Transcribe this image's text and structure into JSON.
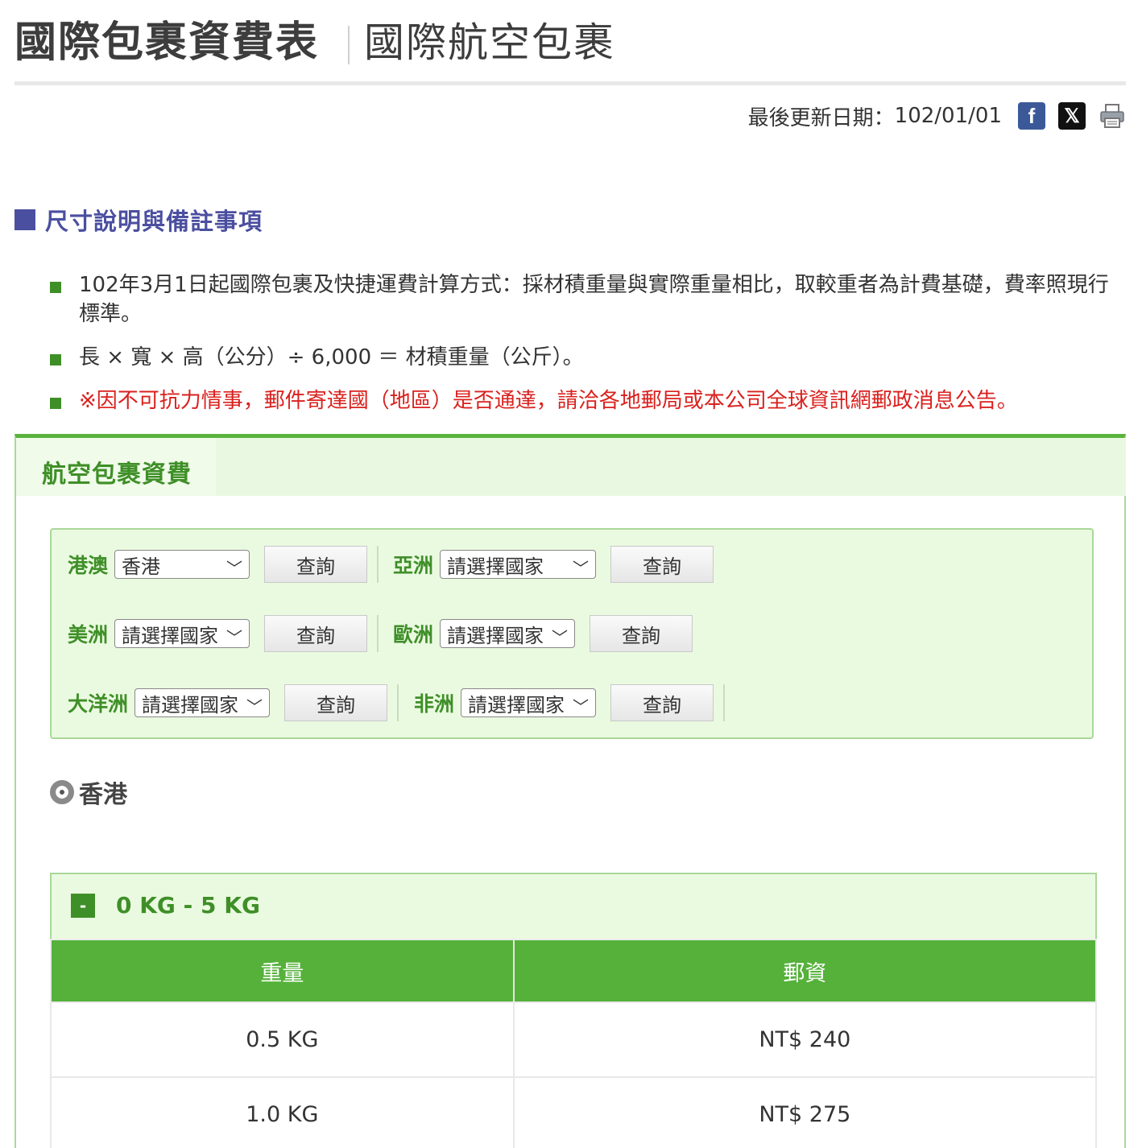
{
  "header": {
    "title": "國際包裹資費表",
    "subtitle": "國際航空包裹",
    "update_label": "最後更新日期：",
    "update_value": "102/01/01",
    "share_facebook_glyph": "f",
    "share_x_glyph": "𝕏"
  },
  "notes_section": {
    "title": "尺寸說明與備註事項",
    "items": [
      "102年3月1日起國際包裹及快捷運費計算方式：採材積重量與實際重量相比，取較重者為計費基礎，費率照現行標準。",
      "長 × 寬 × 高（公分）÷ 6,000 ＝ 材積重量（公斤）。",
      "※因不可抗力情事，郵件寄達國（地區）是否通達，請洽各地郵局或本公司全球資訊網郵政消息公告。"
    ],
    "highlight_color": "#d9211e"
  },
  "panel": {
    "tab_label": "航空包裹資費",
    "query_label": "查詢",
    "regions": [
      {
        "label": "港澳",
        "selected": "香港"
      },
      {
        "label": "亞洲",
        "selected": "請選擇國家"
      },
      {
        "label": "美洲",
        "selected": "請選擇國家"
      },
      {
        "label": "歐洲",
        "selected": "請選擇國家"
      },
      {
        "label": "大洋洲",
        "selected": "請選擇國家"
      },
      {
        "label": "非洲",
        "selected": "請選擇國家"
      }
    ],
    "country": "香港",
    "weight_block": {
      "toggle": "-",
      "range": "0 KG - 5 KG"
    },
    "table": {
      "headers": [
        "重量",
        "郵資"
      ],
      "rows": [
        [
          "0.5 KG",
          "NT$ 240"
        ],
        [
          "1.0 KG",
          "NT$ 275"
        ]
      ]
    }
  },
  "colors": {
    "brand_green": "#55b13a",
    "label_green": "#3f8f28",
    "section_purple": "#4b4fa0"
  },
  "icons": [
    "facebook-icon",
    "x-icon",
    "print-icon",
    "chevron-down-icon",
    "radio-icon",
    "minus-icon"
  ]
}
